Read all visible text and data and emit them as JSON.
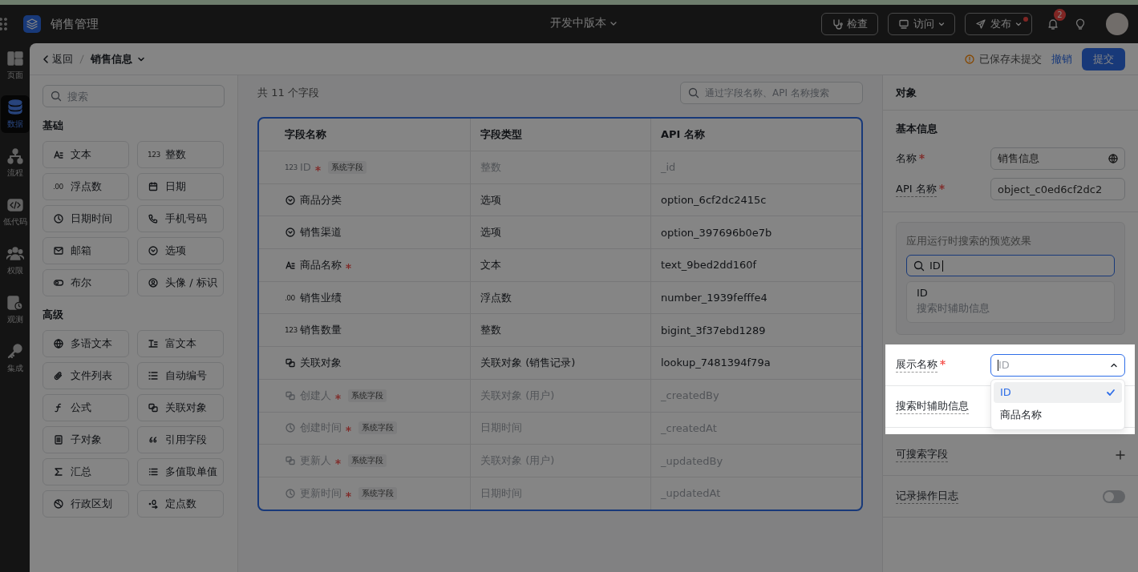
{
  "app": {
    "name": "销售管理",
    "version": "开发中版本"
  },
  "top_actions": [
    {
      "label": "检查",
      "kind": "inspect",
      "caret": false,
      "dot": false
    },
    {
      "label": "访问",
      "kind": "visit",
      "caret": true,
      "dot": false
    },
    {
      "label": "发布",
      "kind": "publish",
      "caret": true,
      "dot": true
    }
  ],
  "notifications": {
    "count": "2"
  },
  "nav": [
    {
      "label": "页面",
      "kind": "pages",
      "selected": false
    },
    {
      "label": "数据",
      "kind": "data",
      "selected": true
    },
    {
      "label": "流程",
      "kind": "flow",
      "selected": false
    },
    {
      "label": "低代码",
      "kind": "code",
      "selected": false
    },
    {
      "label": "权限",
      "kind": "people",
      "selected": false
    },
    {
      "label": "观测",
      "kind": "monitor",
      "selected": false
    },
    {
      "label": "集成",
      "kind": "key",
      "selected": false
    }
  ],
  "breadcrumb": {
    "back": "返回",
    "current": "销售信息"
  },
  "save_status": {
    "message": "已保存未提交",
    "revert": "撤销",
    "submit": "提交"
  },
  "palette": {
    "search": {
      "placeholder": "搜索"
    },
    "groups": [
      {
        "title": "基础",
        "items": [
          {
            "label": "文本",
            "kind": "text"
          },
          {
            "label": "整数",
            "kind": "integer",
            "glyph": "123"
          },
          {
            "label": "浮点数",
            "kind": "float",
            "glyph": ".00"
          },
          {
            "label": "日期",
            "kind": "date"
          },
          {
            "label": "日期时间",
            "kind": "datetime"
          },
          {
            "label": "手机号码",
            "kind": "phone"
          },
          {
            "label": "邮箱",
            "kind": "email"
          },
          {
            "label": "选项",
            "kind": "option"
          },
          {
            "label": "布尔",
            "kind": "bool"
          },
          {
            "label": "头像 / 标识",
            "kind": "avatar"
          }
        ]
      },
      {
        "title": "高级",
        "items": [
          {
            "label": "多语文本",
            "kind": "i18n"
          },
          {
            "label": "富文本",
            "kind": "richtext"
          },
          {
            "label": "文件列表",
            "kind": "file"
          },
          {
            "label": "自动编号",
            "kind": "autonumber"
          },
          {
            "label": "公式",
            "kind": "formula"
          },
          {
            "label": "关联对象",
            "kind": "lookup"
          },
          {
            "label": "子对象",
            "kind": "subobject"
          },
          {
            "label": "引用字段",
            "kind": "reference"
          },
          {
            "label": "汇总",
            "kind": "sum"
          },
          {
            "label": "多值取单值",
            "kind": "multivalue"
          },
          {
            "label": "行政区划",
            "kind": "region"
          },
          {
            "label": "定点数",
            "kind": "decimal"
          }
        ]
      }
    ]
  },
  "fields": {
    "count": "共 11 个字段",
    "search": {
      "placeholder": "通过字段名称、API 名称搜索"
    },
    "columns": [
      "字段名称",
      "字段类型",
      "API 名称"
    ],
    "rows": [
      {
        "name": "ID",
        "kind": "integer",
        "glyph": "123",
        "required": true,
        "tag": "系统字段",
        "muted": true,
        "type": "整数",
        "api": "_id"
      },
      {
        "name": "商品分类",
        "kind": "option",
        "required": false,
        "muted": false,
        "type": "选项",
        "api": "option_6cf2dc2415c"
      },
      {
        "name": "销售渠道",
        "kind": "option",
        "required": false,
        "muted": false,
        "type": "选项",
        "api": "option_397696b0e7b"
      },
      {
        "name": "商品名称",
        "kind": "text",
        "required": true,
        "muted": false,
        "type": "文本",
        "api": "text_9bed2dd160f"
      },
      {
        "name": "销售业绩",
        "kind": "float",
        "glyph": ".00",
        "required": false,
        "muted": false,
        "type": "浮点数",
        "api": "number_1939fefffe4"
      },
      {
        "name": "销售数量",
        "kind": "integer",
        "glyph": "123",
        "required": false,
        "muted": false,
        "type": "整数",
        "api": "bigint_3f37ebd1289"
      },
      {
        "name": "关联对象",
        "kind": "lookup",
        "required": false,
        "muted": false,
        "type": "关联对象 (销售记录)",
        "api": "lookup_7481394f79a"
      },
      {
        "name": "创建人",
        "kind": "lookup",
        "required": true,
        "tag": "系统字段",
        "muted": true,
        "type": "关联对象 (用户)",
        "api": "_createdBy"
      },
      {
        "name": "创建时间",
        "kind": "datetime",
        "required": true,
        "tag": "系统字段",
        "muted": true,
        "type": "日期时间",
        "api": "_createdAt"
      },
      {
        "name": "更新人",
        "kind": "lookup",
        "required": true,
        "tag": "系统字段",
        "muted": true,
        "type": "关联对象 (用户)",
        "api": "_updatedBy"
      },
      {
        "name": "更新时间",
        "kind": "datetime",
        "required": true,
        "tag": "系统字段",
        "muted": true,
        "type": "日期时间",
        "api": "_updatedAt"
      }
    ]
  },
  "object_panel": {
    "title": "对象",
    "section": "基本信息",
    "name_field": {
      "label": "名称",
      "value": "销售信息",
      "required": true
    },
    "api_field": {
      "label": "API 名称",
      "value": "object_c0ed6cf2dc2",
      "required": true
    },
    "preview": {
      "caption": "应用运行时搜索的预览效果",
      "query": "ID",
      "result_title": "ID",
      "result_subtitle": "搜索时辅助信息"
    },
    "display_name": {
      "label": "展示名称",
      "required": true,
      "placeholder": "ID",
      "expanded": true,
      "options": [
        {
          "label": "ID",
          "selected": true
        },
        {
          "label": "商品名称",
          "selected": false
        }
      ]
    },
    "secondary_info": {
      "label": "搜索时辅助信息"
    },
    "searchable": {
      "label": "可搜索字段"
    },
    "audit_log": {
      "label": "记录操作日志",
      "on": false
    }
  }
}
